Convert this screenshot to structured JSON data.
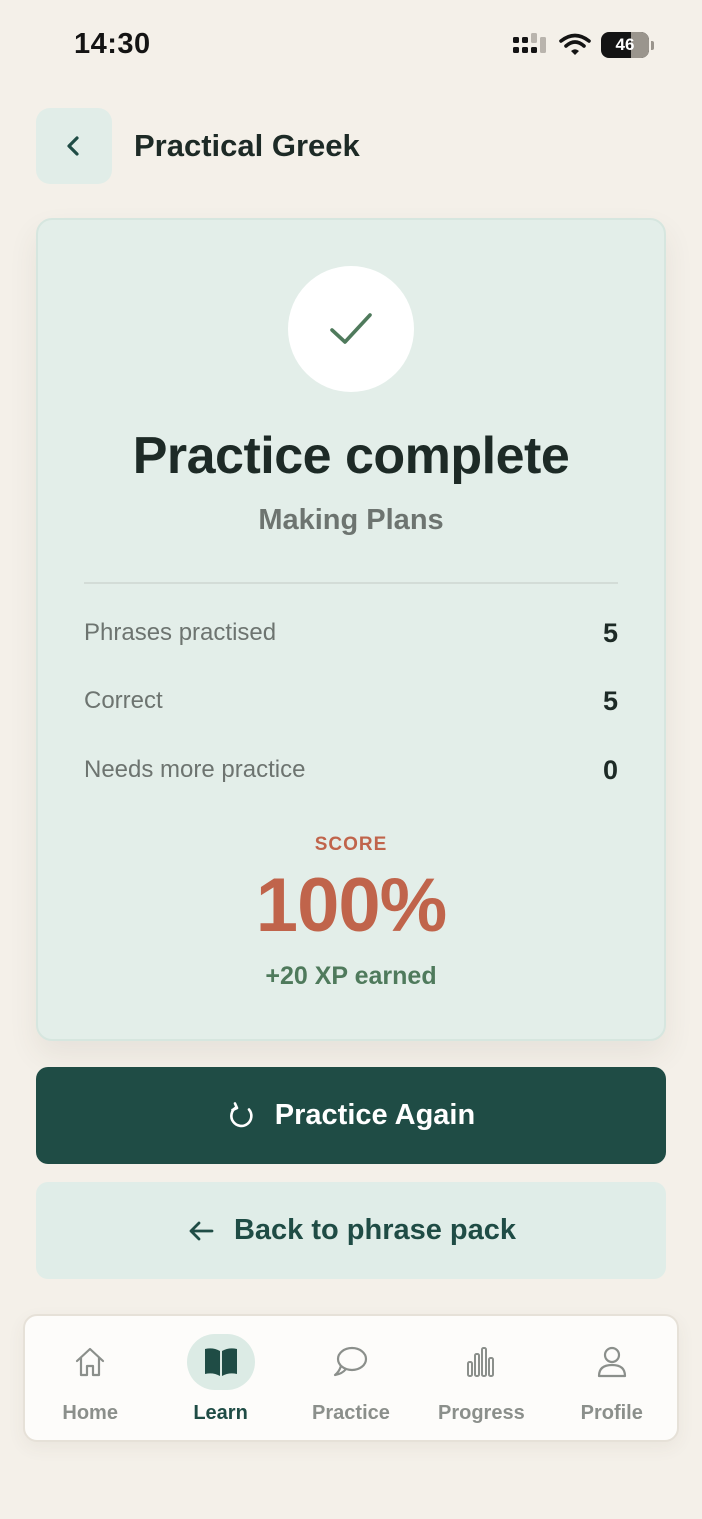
{
  "status_bar": {
    "time": "14:30",
    "battery": "46"
  },
  "header": {
    "title": "Practical Greek",
    "back_icon": "chevron-left-icon"
  },
  "result": {
    "icon": "checkmark-icon",
    "title": "Practice complete",
    "subtitle": "Making Plans",
    "stats": [
      {
        "label": "Phrases practised",
        "value": "5"
      },
      {
        "label": "Correct",
        "value": "5"
      },
      {
        "label": "Needs more practice",
        "value": "0"
      }
    ],
    "score_label": "SCORE",
    "score_value": "100%",
    "xp_earned": "+20 XP earned"
  },
  "actions": {
    "practice_again": {
      "label": "Practice Again",
      "icon": "refresh-icon"
    },
    "back_to_pack": {
      "label": "Back to phrase pack",
      "icon": "arrow-left-icon"
    }
  },
  "tab_bar": {
    "active": "Learn",
    "items": [
      {
        "label": "Home",
        "icon": "home-icon"
      },
      {
        "label": "Learn",
        "icon": "book-icon"
      },
      {
        "label": "Practice",
        "icon": "chat-bubbles-icon"
      },
      {
        "label": "Progress",
        "icon": "bar-chart-icon"
      },
      {
        "label": "Profile",
        "icon": "person-icon"
      }
    ]
  },
  "colors": {
    "background": "#f4f0e9",
    "card": "#e3eee9",
    "primary": "#1f4c45",
    "score": "#c0644b",
    "xp": "#4f7a5c"
  }
}
